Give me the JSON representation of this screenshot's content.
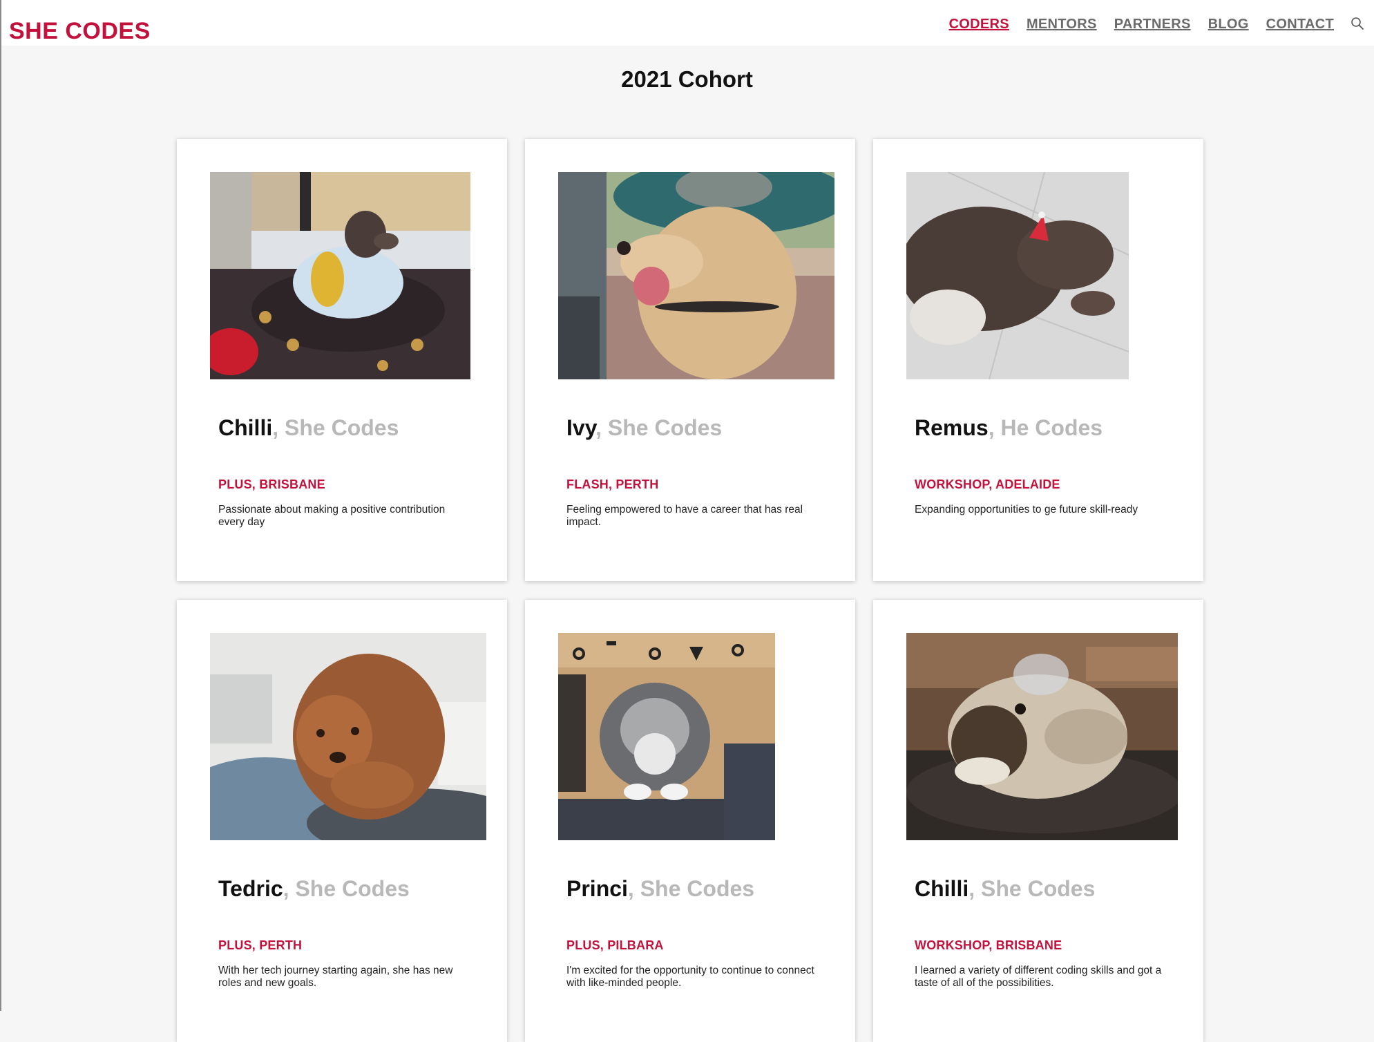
{
  "brand": "SHE CODES",
  "nav": [
    {
      "label": "CODERS",
      "active": true
    },
    {
      "label": "MENTORS",
      "active": false
    },
    {
      "label": "PARTNERS",
      "active": false
    },
    {
      "label": "BLOG",
      "active": false
    },
    {
      "label": "CONTACT",
      "active": false
    }
  ],
  "search_icon": "search-icon",
  "page_title": "2021 Cohort",
  "coders": [
    {
      "name": "Chilli",
      "separator": ",",
      "tag": "She Codes",
      "program": "PLUS, BRISBANE",
      "bio": "Passionate about making a positive contribution every day",
      "photo": "dog-in-sweater-photo"
    },
    {
      "name": "Ivy",
      "separator": ",",
      "tag": "She Codes",
      "program": "FLASH, PERTH",
      "bio": "Feeling empowered to have a career that has real impact.",
      "photo": "dog-in-hat-photo"
    },
    {
      "name": "Remus",
      "separator": ",",
      "tag": "He Codes",
      "program": "WORKSHOP, ADELAIDE",
      "bio": "Expanding opportunities to ge future skill-ready",
      "photo": "dog-party-hat-photo"
    },
    {
      "name": "Tedric",
      "separator": ",",
      "tag": "She Codes",
      "program": "PLUS, PERTH",
      "bio": "With her tech journey starting again, she has new roles and new goals.",
      "photo": "curly-dog-on-couch-photo"
    },
    {
      "name": "Princi",
      "separator": ",",
      "tag": "She Codes",
      "program": "PLUS, PILBARA",
      "bio": "I'm excited for the opportunity to continue to connect with like-minded people.",
      "photo": "cat-in-box-photo"
    },
    {
      "name": "Chilli",
      "separator": ",",
      "tag": "She Codes",
      "program": "WORKSHOP, BRISBANE",
      "bio": "I learned a variety of different coding skills and got a taste of all of the possibilities.",
      "photo": "dog-on-leather-couch-photo"
    }
  ]
}
